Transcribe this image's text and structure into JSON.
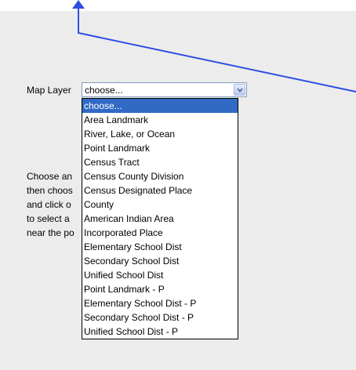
{
  "colors": {
    "panel_background": "#ececec",
    "select_border": "#7f9db9",
    "highlight": "#316ac5",
    "annotation_line": "#2d4de0"
  },
  "map_layer": {
    "label": "Map Layer",
    "selected": "choose...",
    "arrow_icon": "chevron-down-icon",
    "options": [
      "choose...",
      "Area Landmark",
      "River, Lake, or Ocean",
      "Point Landmark",
      "Census Tract",
      "Census County Division",
      "Census Designated Place",
      "County",
      "American Indian Area",
      "Incorporated Place",
      "Elementary School Dist",
      "Secondary School Dist",
      "Unified School Dist",
      "Point Landmark - P",
      "Elementary School Dist - P",
      "Secondary School Dist - P",
      "Unified School Dist - P"
    ]
  },
  "instructions": {
    "lines": [
      "Choose an",
      "then choos",
      "and click o",
      "to select a",
      "near the po"
    ]
  }
}
